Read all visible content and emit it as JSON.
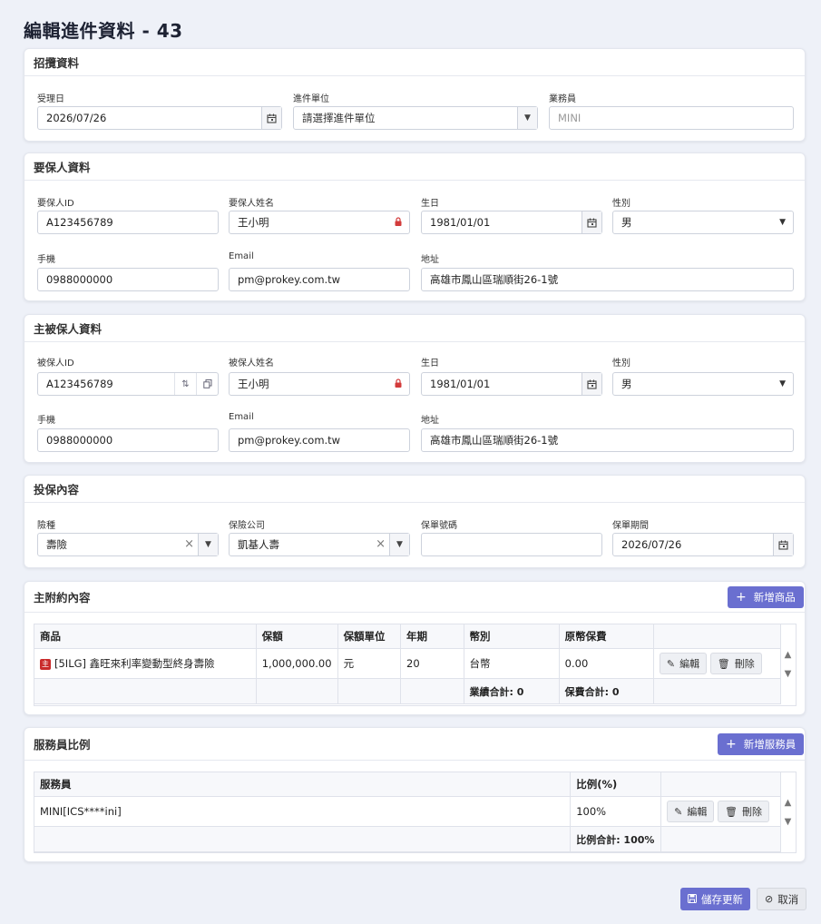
{
  "page": {
    "title": "編輯進件資料 - 43"
  },
  "solicit": {
    "title": "招攬資料",
    "received_date_label": "受理日",
    "received_date": "2026/07/26",
    "unit_label": "進件單位",
    "unit_placeholder": "請選擇進件單位",
    "agent_label": "業務員",
    "agent_value": "MINI"
  },
  "proposer": {
    "title": "要保人資料",
    "id_label": "要保人ID",
    "id": "A123456789",
    "name_label": "要保人姓名",
    "name": "王小明",
    "birth_label": "生日",
    "birth": "1981/01/01",
    "gender_label": "性別",
    "gender": "男",
    "mobile_label": "手機",
    "mobile": "0988000000",
    "email_label": "Email",
    "email": "pm@prokey.com.tw",
    "address_label": "地址",
    "address": "高雄市鳳山區瑞順街26-1號"
  },
  "insured": {
    "title": "主被保人資料",
    "id_label": "被保人ID",
    "id": "A123456789",
    "name_label": "被保人姓名",
    "name": "王小明",
    "birth_label": "生日",
    "birth": "1981/01/01",
    "gender_label": "性別",
    "gender": "男",
    "mobile_label": "手機",
    "mobile": "0988000000",
    "email_label": "Email",
    "email": "pm@prokey.com.tw",
    "address_label": "地址",
    "address": "高雄市鳳山區瑞順街26-1號"
  },
  "policy": {
    "title": "投保內容",
    "type_label": "險種",
    "type": "壽險",
    "company_label": "保險公司",
    "company": "凱基人壽",
    "number_label": "保單號碼",
    "number": "",
    "period_label": "保單期間",
    "period": "2026/07/26"
  },
  "products": {
    "title": "主附約內容",
    "add_label": "新增商品",
    "headers": [
      "商品",
      "保額",
      "保額單位",
      "年期",
      "幣別",
      "原幣保費",
      ""
    ],
    "row": {
      "badge": "主",
      "name": "[5ILG] 鑫旺來利率變動型終身壽險",
      "amount": "1,000,000.00",
      "unit": "元",
      "term": "20",
      "currency": "台幣",
      "premium": "0.00"
    },
    "edit_label": "編輯",
    "delete_label": "刪除",
    "total_sales": "業績合計: 0",
    "total_premium": "保費合計: 0"
  },
  "staff": {
    "title": "服務員比例",
    "add_label": "新增服務員",
    "headers": [
      "服務員",
      "比例(%)",
      ""
    ],
    "row": {
      "name": "MINI[ICS****ini]",
      "ratio": "100%"
    },
    "edit_label": "編輯",
    "delete_label": "刪除",
    "total": "比例合計: 100%"
  },
  "footer": {
    "save_label": "儲存更新",
    "cancel_label": "取消"
  },
  "colors": {
    "primary": "#6a6fd0",
    "lock": "#d33b3b",
    "badge": "#c92a2a"
  }
}
